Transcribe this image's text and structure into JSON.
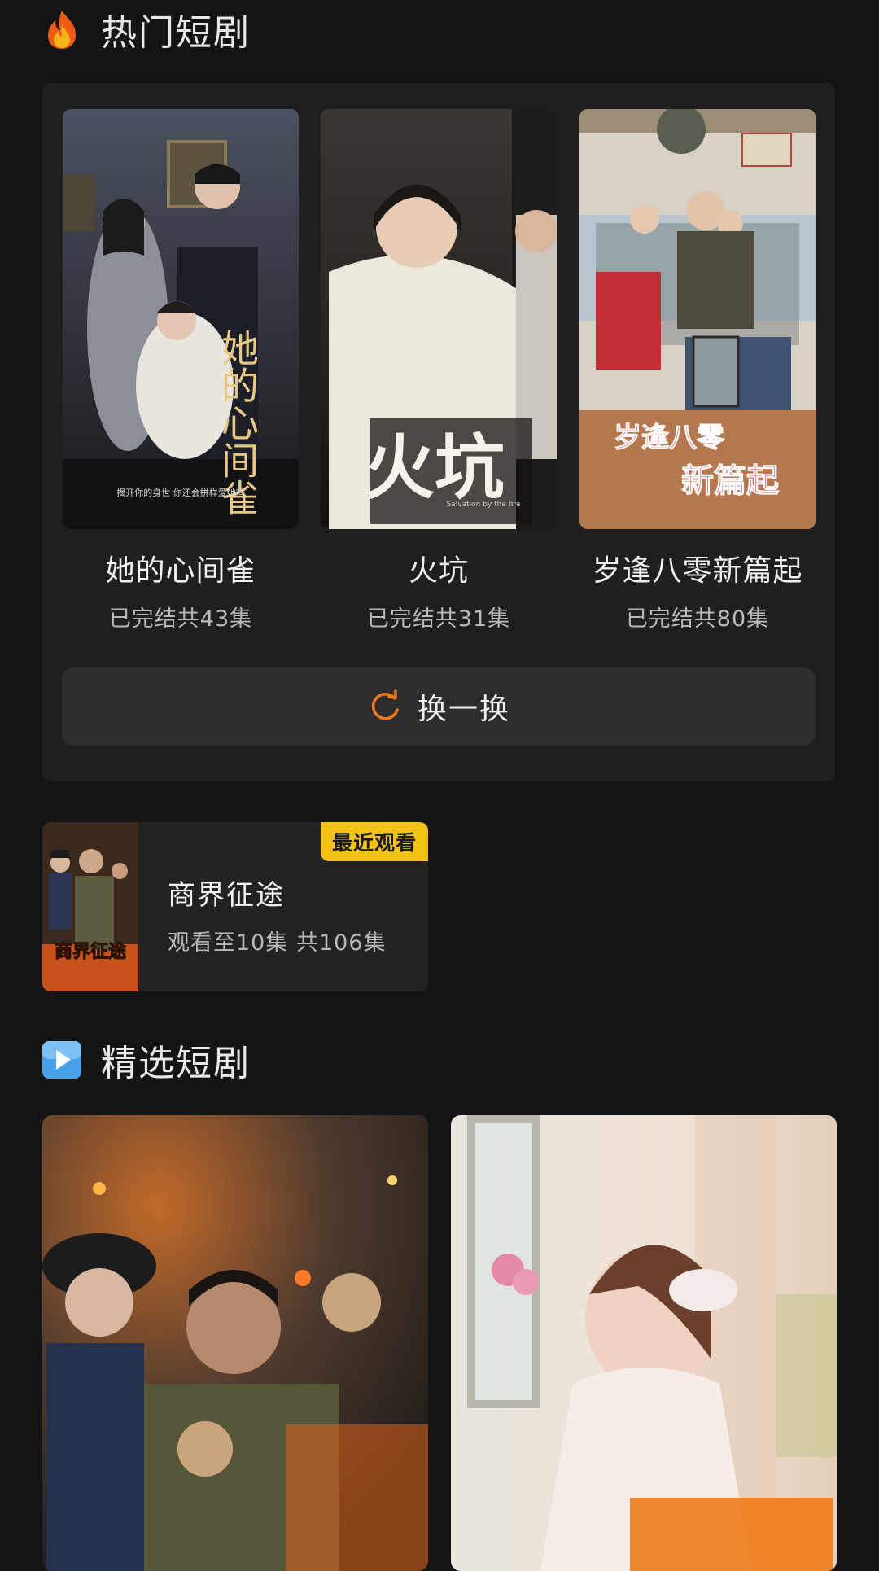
{
  "sections": {
    "hot": {
      "title": "热门短剧",
      "icon": "fire-icon"
    },
    "featured": {
      "title": "精选短剧",
      "icon": "play-icon"
    }
  },
  "hot_items": [
    {
      "title": "她的心间雀",
      "status": "已完结共43集",
      "poster_text": "她的心间雀",
      "poster_caption": "揭开你的身世 你还会拼样爱她吗"
    },
    {
      "title": "火坑",
      "status": "已完结共31集",
      "poster_text": "火坑",
      "poster_caption": "Salvation by the fire"
    },
    {
      "title": "岁逢八零新篇起",
      "status": "已完结共80集",
      "poster_text_1": "岁逢八零",
      "poster_text_2": "新篇起"
    }
  ],
  "refresh_button": {
    "label": "换一换",
    "icon": "refresh-icon"
  },
  "recent": {
    "badge": "最近观看",
    "title": "商界征途",
    "progress": "观看至10集 共106集",
    "thumb_text": "商界征途"
  },
  "colors": {
    "background": "#141414",
    "panel": "#1f1f1f",
    "accent_orange": "#f07a1a",
    "badge_yellow": "#f2c314"
  }
}
